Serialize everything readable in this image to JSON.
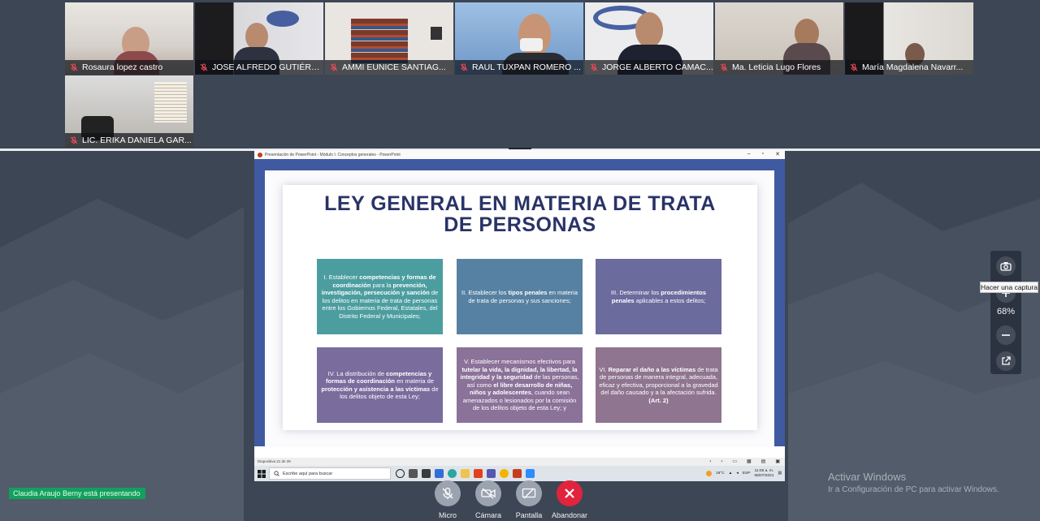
{
  "participants": [
    {
      "name": "Rosaura lopez castro"
    },
    {
      "name": "JOSE ALFREDO GUTIÉRR..."
    },
    {
      "name": "AMMI EUNICE SANTIAG..."
    },
    {
      "name": "RAUL TUXPAN ROMERO ..."
    },
    {
      "name": "JORGE ALBERTO CAMAC..."
    },
    {
      "name": "Ma. Leticia Lugo Flores"
    },
    {
      "name": "María Magdalena Navarr..."
    },
    {
      "name": "LIC. ERIKA DANIELA GAR..."
    }
  ],
  "shared_screen": {
    "window_title": "Presentación de PowerPoint  -  Módulo I. Conceptos generales  -  PowerPoint",
    "slide": {
      "title_line1": "LEY GENERAL EN MATERIA DE TRATA",
      "title_line2": "DE PERSONAS",
      "boxes": [
        {
          "color": "#4c9da0",
          "parts": [
            [
              "I. Establecer ",
              false
            ],
            [
              "competencias y formas de coordinación",
              true
            ],
            [
              " para la ",
              false
            ],
            [
              "prevención, investigación, persecución y sanción",
              true
            ],
            [
              " de los delitos en materia de trata de personas entre los Gobiernos Federal, Estatales, del Distrito Federal y Municipales;",
              false
            ]
          ]
        },
        {
          "color": "#5781a2",
          "parts": [
            [
              "II.    Establecer los ",
              false
            ],
            [
              "tipos penales",
              true
            ],
            [
              " en materia de trata de personas y sus sanciones;",
              false
            ]
          ]
        },
        {
          "color": "#6c6b9e",
          "parts": [
            [
              "III.    Determinar los ",
              false
            ],
            [
              "procedimientos penales",
              true
            ],
            [
              " aplicables a estos delitos;",
              false
            ]
          ]
        },
        {
          "color": "#7a6c9d",
          "parts": [
            [
              "IV.   La distribución de ",
              false
            ],
            [
              "competencias y formas de coordinación",
              true
            ],
            [
              " en materia de ",
              false
            ],
            [
              "protección y asistencia a las víctimas",
              true
            ],
            [
              " de los delitos objeto de esta Ley;",
              false
            ]
          ]
        },
        {
          "color": "#8b7299",
          "parts": [
            [
              "V.    Establecer mecanismos efectivos para ",
              false
            ],
            [
              "tutelar la vida, la dignidad, la libertad, la integridad y la seguridad",
              true
            ],
            [
              " de las personas, así como ",
              false
            ],
            [
              "el libre desarrollo de niñas, niños y adolescentes",
              true
            ],
            [
              ", cuando sean amenazados o lesionados por la comisión de los delitos objeto de esta Ley; y",
              false
            ]
          ]
        },
        {
          "color": "#8f7590",
          "parts": [
            [
              "VI.   ",
              false
            ],
            [
              "Reparar el daño a las víctimas",
              true
            ],
            [
              " de trata de personas de manera integral, adecuada, eficaz y efectiva, proporcional a la gravedad del daño causado y a la afectación sufrida. ",
              false
            ],
            [
              "(Art. 2)",
              true
            ]
          ]
        }
      ]
    },
    "status_bar": "Diapositiva 21 de 39",
    "taskbar": {
      "search_placeholder": "Escribe aquí para buscar",
      "weather": "19°C",
      "language": "ESP",
      "time": "11:05 a. m.",
      "date": "06/07/2021"
    }
  },
  "zoom": {
    "percent": "68%",
    "tooltip": "Hacer una captura"
  },
  "presenting_text": "Claudia Araujo Berny está presentando",
  "controls": {
    "mic": "Micro",
    "camera": "Cámara",
    "screen": "Pantalla",
    "leave": "Abandonar"
  },
  "watermark": {
    "line1": "Activar Windows",
    "line2": "Ir a Configuración de PC para activar Windows."
  }
}
